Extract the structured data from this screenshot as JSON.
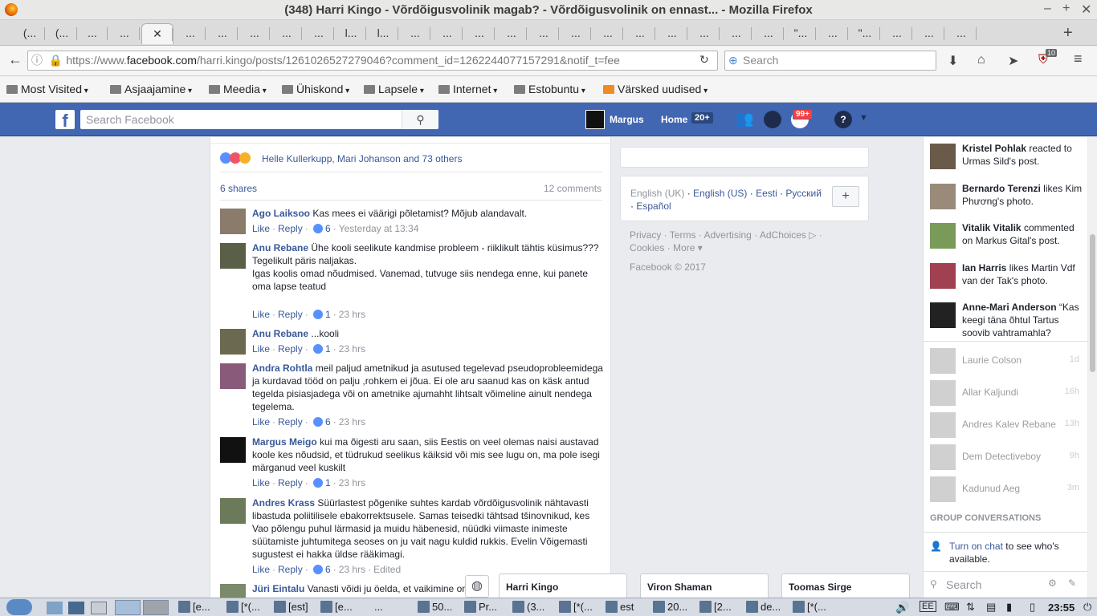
{
  "window": {
    "title": "(348) Harri Kingo - Võrdõigusvolinik magab? - Võrdõigusvolinik on ennast... - Mozilla Firefox",
    "minimize": "–",
    "maximize": "+",
    "close": "✕"
  },
  "tabs": [
    "(...",
    "(...",
    "...",
    "...",
    "✕",
    "...",
    "...",
    "...",
    "...",
    "...",
    "l...",
    "l...",
    "...",
    "...",
    "...",
    "...",
    "...",
    "...",
    "...",
    "...",
    "...",
    "...",
    "...",
    "...",
    "\"...",
    "...",
    "\"...",
    "...",
    "...",
    "..."
  ],
  "toolbar": {
    "url_prefix": "https://www.",
    "url_domain": "facebook.com",
    "url_rest": "/harri.kingo/posts/1261026527279046?comment_id=1262244077157291&notif_t=fee",
    "search_placeholder": "Search",
    "addon_badge": "10"
  },
  "bookmarks": [
    "Most Visited",
    "Asjaajamine",
    "Meedia",
    "Ühiskond",
    "Lapsele",
    "Internet",
    "Estobuntu",
    "Värsked uudised"
  ],
  "fb": {
    "logo": "f",
    "search_placeholder": "Search Facebook",
    "user": "Margus",
    "home": "Home",
    "home_badge": "20+",
    "notif_badge": "99+"
  },
  "post": {
    "reactions_text": "Helle Kullerkupp, Mari Johanson and 73 others",
    "shares": "6 shares",
    "comments_count": "12 comments"
  },
  "comments": [
    {
      "name": "Ago Laiksoo",
      "text": "Kas mees ei väärigi põletamist? Mõjub alandavalt.",
      "likes": "6",
      "time": "Yesterday at 13:34"
    },
    {
      "name": "Anu Rebane",
      "text": "Ühe kooli seelikute kandmise probleem - riiklikult tähtis küsimus???",
      "text2": "Tegelikult päris naljakas.",
      "text3": "Igas koolis omad nõudmised. Vanemad, tutvuge siis nendega enne, kui panete oma lapse teatud",
      "likes": "1",
      "time": "23 hrs"
    },
    {
      "name": "Anu Rebane",
      "text": "...kooli",
      "likes": "1",
      "time": "23 hrs"
    },
    {
      "name": "Andra Rohtla",
      "text": "meil paljud ametnikud ja asutused tegelevad pseudoprobleemidega ja kurdavad tööd on palju ,rohkem ei jõua. Ei ole aru saanud kas on käsk antud tegelda pisiasjadega või on ametnike ajumahht lihtsalt võimeline ainult nendega tegelema.",
      "likes": "6",
      "time": "23 hrs"
    },
    {
      "name": "Margus Meigo",
      "text": "kui ma õigesti aru saan, siis Eestis on veel olemas naisi austavad koole kes nõudsid, et tüdrukud seelikus käiksid või mis see lugu on, ma pole isegi märganud veel kuskilt",
      "likes": "1",
      "time": "23 hrs"
    },
    {
      "name": "Andres Krass",
      "text": "Süürlastest põgenike suhtes kardab võrdõigusvolinik nähtavasti libastuda poliitilisele ebakorrektsusele. Samas teisedki tähtsad tšinovnikud, kes Vao põlengu puhul lärmasid ja muidu häbenesid, nüüdki viimaste inimeste süütamiste juhtumitega seoses on ju vait nagu kuldid rukkis. Evelin Võigemasti sugustest ei hakka üldse rääkimagi.",
      "likes": "6",
      "time": "23 hrs",
      "edited": "Edited"
    },
    {
      "name": "Jüri Eintalu",
      "text": "Vanasti võidi ju öelda, et vaikimine on kuld",
      "likes": "",
      "time": ""
    }
  ],
  "comment_actions": {
    "like": "Like",
    "reply": "Reply",
    "dot": "·"
  },
  "languages": {
    "current": "English (UK)",
    "items": [
      "English (US)",
      "Eesti",
      "Русский",
      "Español"
    ],
    "add": "+"
  },
  "footer": {
    "links": [
      "Privacy",
      "Terms",
      "Advertising",
      "AdChoices",
      "Cookies",
      "More"
    ],
    "copyright": "Facebook © 2017"
  },
  "ticker": [
    {
      "name": "Kristel Pohlak",
      "rest": "reacted to Urmas Sild's post."
    },
    {
      "name": "Bernardo Terenzi",
      "rest": "likes Kim Phương's photo."
    },
    {
      "name": "Vitalik Vitalik",
      "rest": "commented on Markus Gital's post."
    },
    {
      "name": "Ian Harris",
      "rest": "likes Martin Vdf van der Tak's photo."
    },
    {
      "name": "Anne-Mari Anderson",
      "rest": "“Kas keegi täna õhtul Tartus soovib vahtramahla?"
    }
  ],
  "chat": {
    "contacts": [
      {
        "name": "Laurie Colson",
        "time": "1d"
      },
      {
        "name": "Allar Kaljundi",
        "time": "16h"
      },
      {
        "name": "Andres Kalev Rebane",
        "time": "13h"
      },
      {
        "name": "Dem Detectiveboy",
        "time": "9h"
      },
      {
        "name": "Kadunud Aeg",
        "time": "3m"
      }
    ],
    "group_header": "GROUP CONVERSATIONS",
    "turn_on_link": "Turn on chat",
    "turn_on_rest": "to see who's available.",
    "search_placeholder": "Search"
  },
  "chat_tabs": [
    "Harri Kingo",
    "Viron Shaman",
    "Toomas Sirge"
  ],
  "taskbar": {
    "items": [
      "[e...",
      "[*(...",
      "[est]",
      "[e...",
      "...",
      "50...",
      "Pr...",
      "(3...",
      "[*(...",
      "est",
      "20...",
      "[2...",
      "de...",
      "[*(..."
    ],
    "clock": "23:55"
  }
}
